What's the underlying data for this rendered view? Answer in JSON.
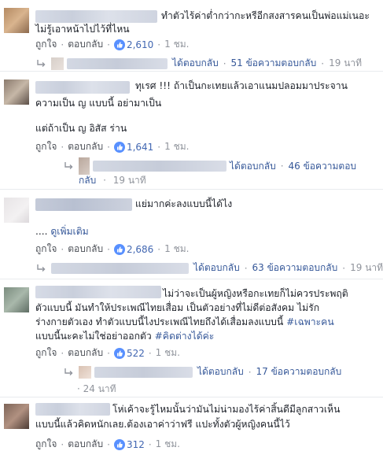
{
  "comments": [
    {
      "text_lines": [
        "ทำตัวไร้ค่าต่ำกว่ากะหรีอีกสงสารคนเป็นพ่อแม่เนอะ",
        "ไม่รู้เอาหน้าไปไว้ที่ไหน"
      ],
      "like_label": "ถูกใจ",
      "reply_label": "ตอบกลับ",
      "like_count": "2,610",
      "time": "1 ชม.",
      "reply_summary": {
        "replied": "ได้ตอบกลับ",
        "count_text": "51 ข้อความตอบกลับ",
        "time": "19 นาที"
      }
    },
    {
      "text_lines": [
        "ทุเรศ !!! ถ้าเป็นกะเทยแล้วเอาแนมปลอมมาประจาน",
        "ความเป็น ญ แบบนี้ อย่ามาเป็น",
        "",
        "แต่ถ้าเป็น ญ อิสัส ร่าน"
      ],
      "like_label": "ถูกใจ",
      "reply_label": "ตอบกลับ",
      "like_count": "1,641",
      "time": "1 ชม.",
      "reply_summary": {
        "replied": "ได้ตอบกลับ",
        "count_text": "46 ข้อความตอบ",
        "count_text_2": "กลับ",
        "time": "19 นาที"
      }
    },
    {
      "text_lines": [
        "แย่มากค่ะลงแบบนี้ได้ไง"
      ],
      "see_more": "ดูเพิ่มเติม",
      "ellipsis": "....",
      "like_label": "ถูกใจ",
      "reply_label": "ตอบกลับ",
      "like_count": "2,686",
      "time": "1 ชม.",
      "reply_summary": {
        "replied": "ได้ตอบกลับ",
        "count_text": "63 ข้อความตอบกลับ",
        "time": "19 นาที"
      }
    },
    {
      "text_lines": [
        "ไม่ว่าจะเป็นผู้หญิงหรือกะเทยก็ไม่ควรประพฤติ",
        "ตัวแบบนี้ มันทำให้ประเพณีไทยเสื่อม เป็นตัวอย่างที่ไม่ดีต่อสังคม ไม่รัก",
        "ร่างกายตัวเอง ทำตัวแบบนี้ไงประเพณีไทยถึงได้เสื่อมลงแบบนี้ ",
        "แบบนี้นะคะไม่ใช่อย่าออกตัว "
      ],
      "hashtag_1": "#เฉพาะคน",
      "hashtag_2": "#คิดต่างได้ค่ะ",
      "like_label": "ถูกใจ",
      "reply_label": "ตอบกลับ",
      "like_count": "522",
      "time": "1 ชม.",
      "reply_summary": {
        "replied": "ได้ตอบกลับ",
        "count_text": "17 ข้อความตอบกลับ",
        "time": "24 นาที"
      }
    },
    {
      "text_lines": [
        "โห่เค้าจะรู้ไหมนั้นว่ามันไม่น่ามองไร้ค่าสิ้นดีมีลูกสาวเห็น",
        "แบบนี้แล้วคิดหนักเลย.ต้องเอาค่าว่าฟรี แปะทั้งตัวผู้หญิงคนนี้ไว้"
      ],
      "like_label": "ถูกใจ",
      "reply_label": "ตอบกลับ",
      "like_count": "312",
      "time": "1 ชม."
    }
  ],
  "colors": {
    "link": "#365899",
    "meta": "#90949c",
    "like_blue": "#4267b2"
  }
}
